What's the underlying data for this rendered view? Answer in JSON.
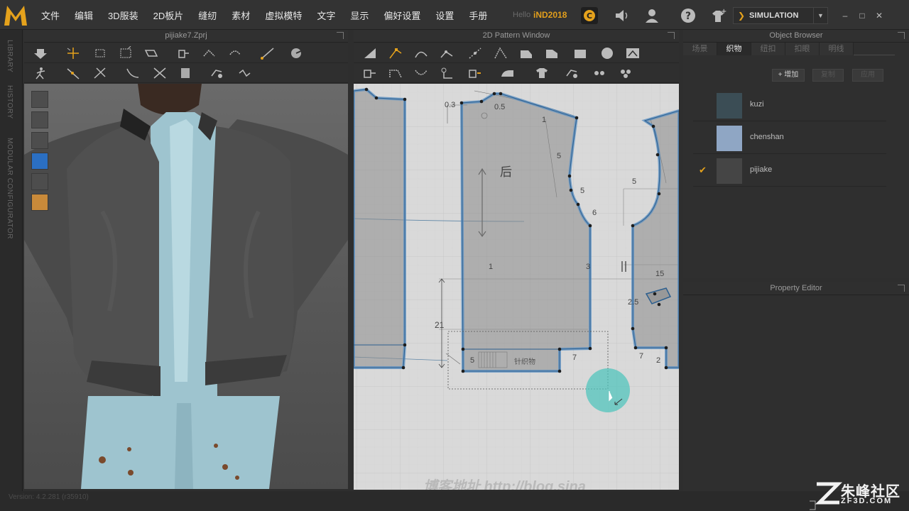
{
  "menu": [
    "文件",
    "编辑",
    "3D服装",
    "2D板片",
    "缝纫",
    "素材",
    "虚拟模特",
    "文字",
    "显示",
    "偏好设置",
    "设置",
    "手册"
  ],
  "header": {
    "hello": "Hello",
    "user": "iND2018",
    "simulation": "SIMULATION"
  },
  "side_tabs": [
    "LIBRARY",
    "HISTORY",
    "MODULAR CONFIGURATOR"
  ],
  "panel3d": {
    "title": "pijiake7.Zprj"
  },
  "panel2d": {
    "title": "2D Pattern Window"
  },
  "object_browser": {
    "title": "Object Browser",
    "tabs": [
      "场景",
      "织物",
      "纽扣",
      "扣眼",
      "明线"
    ],
    "active_tab": 1,
    "buttons": [
      "+ 增加",
      "复制",
      "应用"
    ],
    "fabrics": [
      {
        "name": "kuzi",
        "color": "#3b4d55",
        "checked": false
      },
      {
        "name": "chenshan",
        "color": "#8fa6c4",
        "checked": false
      },
      {
        "name": "pijiake",
        "color": "#454545",
        "checked": true
      }
    ]
  },
  "property_editor": {
    "title": "Property Editor"
  },
  "status": {
    "version": "Version: 4.2.281 (r35910)"
  },
  "watermark": {
    "cn": "朱峰社区",
    "en": "ZF3D.COM"
  },
  "pattern_labels": [
    "0.3",
    "0.5",
    "1",
    "5",
    "5",
    "6",
    "后",
    "1",
    "21",
    "5",
    "7",
    "针织物",
    "5",
    "3",
    "15",
    "2.5",
    "7",
    "2"
  ],
  "pattern_url_text": "博客地址 http://blog.sina",
  "colors": {
    "accent": "#e5a21c",
    "pattern_outline": "#4f83b6",
    "cursor": "#49c3bb"
  }
}
